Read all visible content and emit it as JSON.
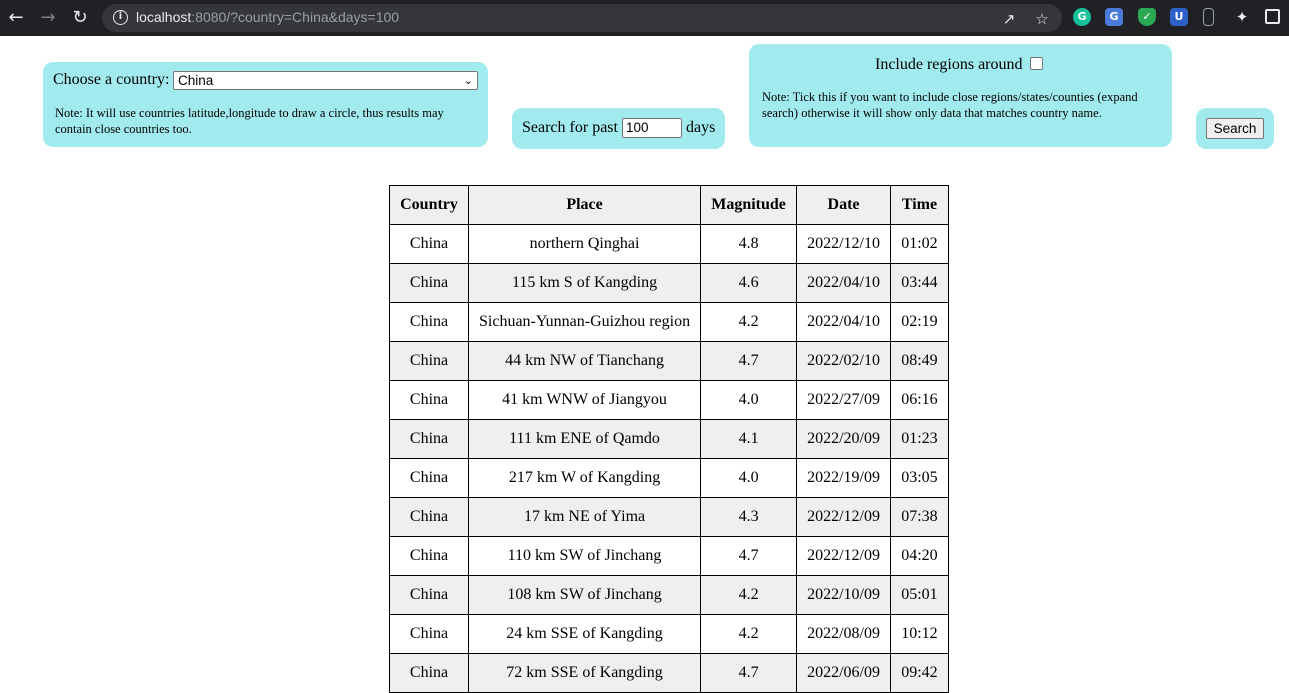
{
  "browser": {
    "url_host": "localhost",
    "url_rest": ":8080/?country=China&days=100",
    "icons": [
      "back-icon",
      "forward-icon",
      "reload-icon",
      "info-icon",
      "share-icon",
      "star-icon"
    ],
    "extensions": [
      "grammarly-icon",
      "translate-icon",
      "shield-icon",
      "bitwarden-icon",
      "phone-icon",
      "puzzle-icon",
      "sidepanel-icon"
    ]
  },
  "country_panel": {
    "label": "Choose a country:",
    "selected": "China",
    "note": "Note: It will use countries latitude,longitude to draw a circle, thus results may contain close countries too."
  },
  "days_panel": {
    "prefix": "Search for past",
    "value": "100",
    "suffix": "days"
  },
  "include_panel": {
    "label": "Include regions around",
    "checked": false,
    "note": "Note: Tick this if you want to include close regions/states/counties (expand search) otherwise it will show only data that matches country name."
  },
  "search_button": {
    "label": "Search"
  },
  "table": {
    "headers": [
      "Country",
      "Place",
      "Magnitude",
      "Date",
      "Time"
    ],
    "rows": [
      [
        "China",
        "northern Qinghai",
        "4.8",
        "2022/12/10",
        "01:02"
      ],
      [
        "China",
        "115 km S of Kangding",
        "4.6",
        "2022/04/10",
        "03:44"
      ],
      [
        "China",
        "Sichuan-Yunnan-Guizhou region",
        "4.2",
        "2022/04/10",
        "02:19"
      ],
      [
        "China",
        "44 km NW of Tianchang",
        "4.7",
        "2022/02/10",
        "08:49"
      ],
      [
        "China",
        "41 km WNW of Jiangyou",
        "4.0",
        "2022/27/09",
        "06:16"
      ],
      [
        "China",
        "111 km ENE of Qamdo",
        "4.1",
        "2022/20/09",
        "01:23"
      ],
      [
        "China",
        "217 km W of Kangding",
        "4.0",
        "2022/19/09",
        "03:05"
      ],
      [
        "China",
        "17 km NE of Yima",
        "4.3",
        "2022/12/09",
        "07:38"
      ],
      [
        "China",
        "110 km SW of Jinchang",
        "4.7",
        "2022/12/09",
        "04:20"
      ],
      [
        "China",
        "108 km SW of Jinchang",
        "4.2",
        "2022/10/09",
        "05:01"
      ],
      [
        "China",
        "24 km SSE of Kangding",
        "4.2",
        "2022/08/09",
        "10:12"
      ],
      [
        "China",
        "72 km SSE of Kangding",
        "4.7",
        "2022/06/09",
        "09:42"
      ]
    ]
  }
}
